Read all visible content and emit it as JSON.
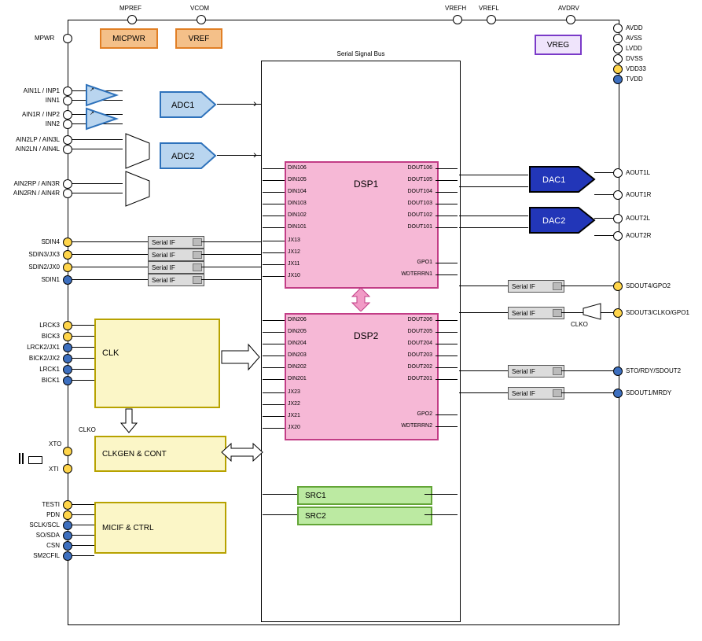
{
  "domain": "Diagram",
  "chart_data": {
    "type": "block-diagram",
    "title": "Serial Signal Bus",
    "blocks": [
      {
        "name": "MICPWR",
        "group": "power"
      },
      {
        "name": "VREF",
        "group": "power"
      },
      {
        "name": "VREG",
        "group": "power"
      },
      {
        "name": "ADC1",
        "group": "adc"
      },
      {
        "name": "ADC2",
        "group": "adc"
      },
      {
        "name": "DSP1",
        "group": "dsp"
      },
      {
        "name": "DSP2",
        "group": "dsp"
      },
      {
        "name": "DAC1",
        "group": "dac"
      },
      {
        "name": "DAC2",
        "group": "dac"
      },
      {
        "name": "SRC1",
        "group": "src"
      },
      {
        "name": "SRC2",
        "group": "src"
      },
      {
        "name": "CLK",
        "group": "clock"
      },
      {
        "name": "CLKGEN & CONT",
        "group": "clock"
      },
      {
        "name": "MICIF & CTRL",
        "group": "ctrl"
      },
      {
        "name": "Serial IF",
        "group": "io",
        "instances": 8
      }
    ],
    "dsp1_inputs": [
      "DIN106",
      "DIN105",
      "DIN104",
      "DIN103",
      "DIN102",
      "DIN101",
      "JX13",
      "JX12",
      "JX11",
      "JX10"
    ],
    "dsp1_outputs": [
      "DOUT106",
      "DOUT105",
      "DOUT104",
      "DOUT103",
      "DOUT102",
      "DOUT101",
      "",
      "",
      "GPO1",
      "WDTERRN1"
    ],
    "dsp2_inputs": [
      "DIN206",
      "DIN205",
      "DIN204",
      "DIN203",
      "DIN202",
      "DIN201",
      "JX23",
      "JX22",
      "JX21",
      "JX20"
    ],
    "dsp2_outputs": [
      "DOUT206",
      "DOUT205",
      "DOUT204",
      "DOUT203",
      "DOUT202",
      "DOUT201",
      "",
      "",
      "GPO2",
      "WDTERRN2"
    ]
  },
  "top_pins": {
    "mpref": "MPREF",
    "vcom": "VCOM",
    "vrefh": "VREFH",
    "vrefl": "VREFL",
    "avdrv": "AVDRV"
  },
  "top_blocks": {
    "micpwr": "MICPWR",
    "vref": "VREF",
    "vreg": "VREG"
  },
  "left_top": {
    "mpwr": "MPWR"
  },
  "right_power": [
    "AVDD",
    "AVSS",
    "LVDD",
    "DVSS",
    "VDD33",
    "TVDD"
  ],
  "analog_in": [
    "AIN1L / INP1",
    "INN1",
    "AIN1R / INP2",
    "INN2",
    "AIN2LP / AIN3L",
    "AIN2LN / AIN4L",
    "AIN2RP / AIN3R",
    "AIN2RN / AIN4R"
  ],
  "adc": {
    "adc1": "ADC1",
    "adc2": "ADC2"
  },
  "dac": {
    "dac1": "DAC1",
    "dac2": "DAC2"
  },
  "aout": [
    "AOUT1L",
    "AOUT1R",
    "AOUT2L",
    "AOUT2R"
  ],
  "sdin": [
    "SDIN4",
    "SDIN3/JX3",
    "SDIN2/JX0",
    "SDIN1"
  ],
  "sdout": [
    "SDOUT4/GPO2",
    "SDOUT3/CLKO/GPO1",
    "STO/RDY/SDOUT2",
    "SDOUT1/MRDY"
  ],
  "serialIF": "Serial IF",
  "clk_pins": [
    "LRCK3",
    "BICK3",
    "LRCK2/JX1",
    "BICK2/JX2",
    "LRCK1",
    "BICK1"
  ],
  "clk": {
    "clk": "CLK",
    "clkgen": "CLKGEN & CONT",
    "micif": "MICIF & CTRL",
    "clko": "CLKO"
  },
  "xtal": [
    "XTO",
    "XTI"
  ],
  "ctrl_pins": [
    "TESTI",
    "PDN",
    "SCLK/SCL",
    "SO/SDA",
    "CSN",
    "SM2CFIL"
  ],
  "dsp": {
    "title1": "DSP1",
    "title2": "DSP2",
    "din1": [
      "DIN106",
      "DIN105",
      "DIN104",
      "DIN103",
      "DIN102",
      "DIN101"
    ],
    "jx1": [
      "JX13",
      "JX12",
      "JX11",
      "JX10"
    ],
    "dout1": [
      "DOUT106",
      "DOUT105",
      "DOUT104",
      "DOUT103",
      "DOUT102",
      "DOUT101"
    ],
    "extra1": [
      "GPO1",
      "WDTERRN1"
    ],
    "din2": [
      "DIN206",
      "DIN205",
      "DIN204",
      "DIN203",
      "DIN202",
      "DIN201"
    ],
    "jx2": [
      "JX23",
      "JX22",
      "JX21",
      "JX20"
    ],
    "dout2": [
      "DOUT206",
      "DOUT205",
      "DOUT204",
      "DOUT203",
      "DOUT202",
      "DOUT201"
    ],
    "extra2": [
      "GPO2",
      "WDTERRN2"
    ]
  },
  "src": {
    "src1": "SRC1",
    "src2": "SRC2"
  },
  "bus_title": "Serial Signal Bus"
}
